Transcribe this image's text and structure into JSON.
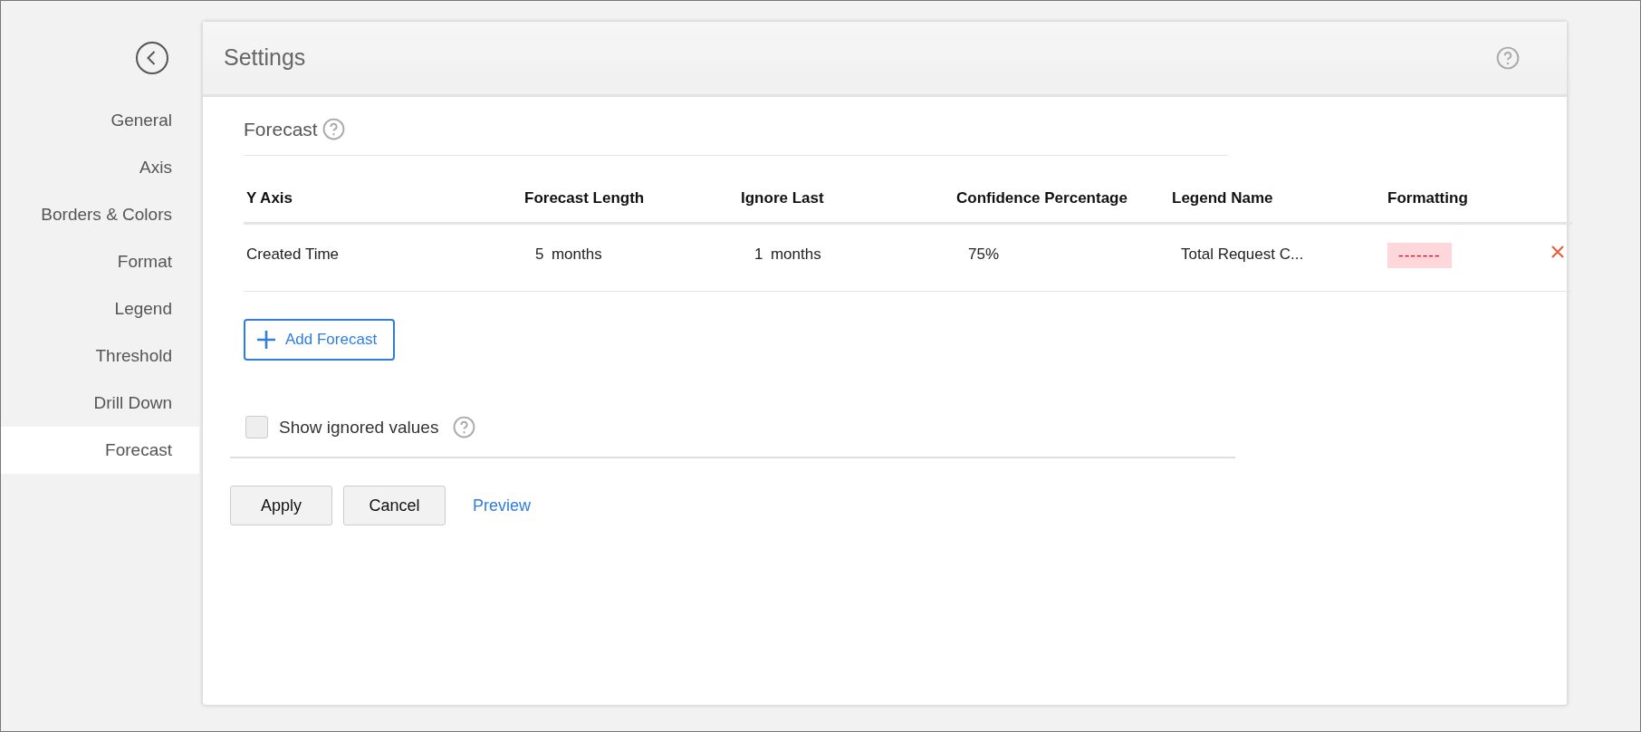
{
  "sidebar": {
    "items": [
      {
        "label": "General",
        "selected": false
      },
      {
        "label": "Axis",
        "selected": false
      },
      {
        "label": "Borders & Colors",
        "selected": false
      },
      {
        "label": "Format",
        "selected": false
      },
      {
        "label": "Legend",
        "selected": false
      },
      {
        "label": "Threshold",
        "selected": false
      },
      {
        "label": "Drill Down",
        "selected": false
      },
      {
        "label": "Forecast",
        "selected": true
      }
    ]
  },
  "panel": {
    "title": "Settings",
    "section_title": "Forecast",
    "table": {
      "columns": [
        "Y Axis",
        "Forecast Length",
        "Ignore Last",
        "Confidence Percentage",
        "Legend Name",
        "Formatting"
      ],
      "rows": [
        {
          "y_axis": "Created Time",
          "forecast_length": "5",
          "forecast_unit": "months",
          "ignore_last": "1",
          "ignore_unit": "months",
          "confidence": "75%",
          "legend_name": "Total Request C...",
          "formatting": "-------"
        }
      ]
    },
    "add_button": "Add Forecast",
    "show_ignored": {
      "label": "Show ignored values",
      "checked": false
    },
    "buttons": [
      "Apply",
      "Cancel"
    ],
    "preview_link": "Preview"
  }
}
